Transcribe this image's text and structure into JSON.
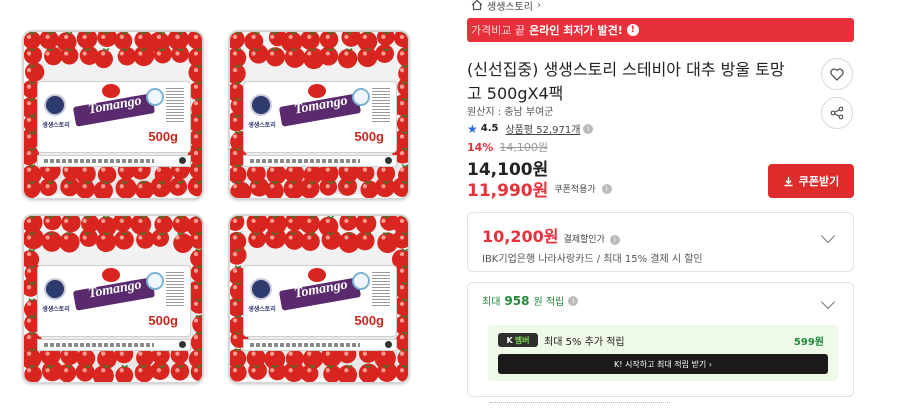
{
  "breadcrumb": {
    "label": "생생스토리"
  },
  "promo": {
    "prefix": "가격비교 끝",
    "highlight": "온라인 최저가 발견!",
    "icon": "exclamation-icon"
  },
  "product": {
    "title": "(신선집중) 생생스토리 스테비아 대추 방울 토망고 500gX4팩",
    "origin": "원산지 : 충남 부여군",
    "rating": "4.5",
    "reviews": "상품평 52,971개",
    "discount_pct": "14%",
    "original_price": "14,100원",
    "price": "14,100원",
    "sale_price": "11,990원",
    "sale_label": "쿠폰적용가",
    "coupon_button": "쿠폰받기"
  },
  "packaging": {
    "logo": "Tomango",
    "weight": "500g",
    "brand": "생생스토리",
    "colors": {
      "tomato": "#d9251f",
      "ribbon": "#5b2a6e",
      "brand_blue": "#2d3a6e"
    }
  },
  "payment_discount": {
    "amount": "10,200원",
    "label": "결제할인가",
    "description": "IBK기업은행 나라사랑카드 / 최대 15% 결제 시 할인"
  },
  "points": {
    "prefix": "최대",
    "amount": "958",
    "suffix": "원 적립",
    "member_badge_k": "K",
    "member_badge_m": "멤버",
    "member_text": "최대 5% 추가 적립",
    "member_amount": "599원",
    "cta": "K! 시작하고 최대 적립 받기  ›"
  },
  "colors": {
    "accent_red": "#e8303a",
    "coupon_red": "#de2b2b",
    "point_green": "#1f8a3a",
    "member_bg": "#eef9e7"
  }
}
